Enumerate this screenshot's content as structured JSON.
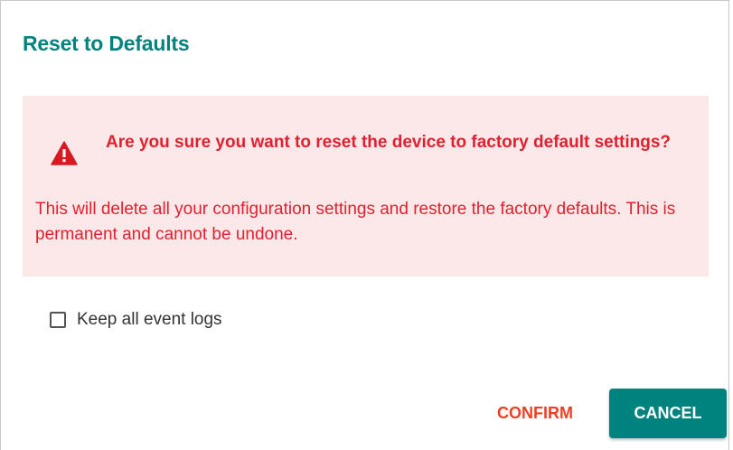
{
  "dialog": {
    "title": "Reset to Defaults",
    "warning": {
      "icon": "warning-triangle-icon",
      "heading": "Are you sure you want to reset the device to factory default settings?",
      "body": "This will delete all your configuration settings and restore the factory defaults. This is permanent and cannot be undone."
    },
    "checkbox": {
      "label": "Keep all event logs",
      "checked": false
    },
    "actions": {
      "confirm_label": "CONFIRM",
      "cancel_label": "CANCEL"
    }
  },
  "colors": {
    "title": "#00827f",
    "warning_bg": "#fde8e9",
    "warning_text": "#e0202f",
    "confirm_text": "#ee3f23",
    "cancel_bg": "#00827f"
  }
}
